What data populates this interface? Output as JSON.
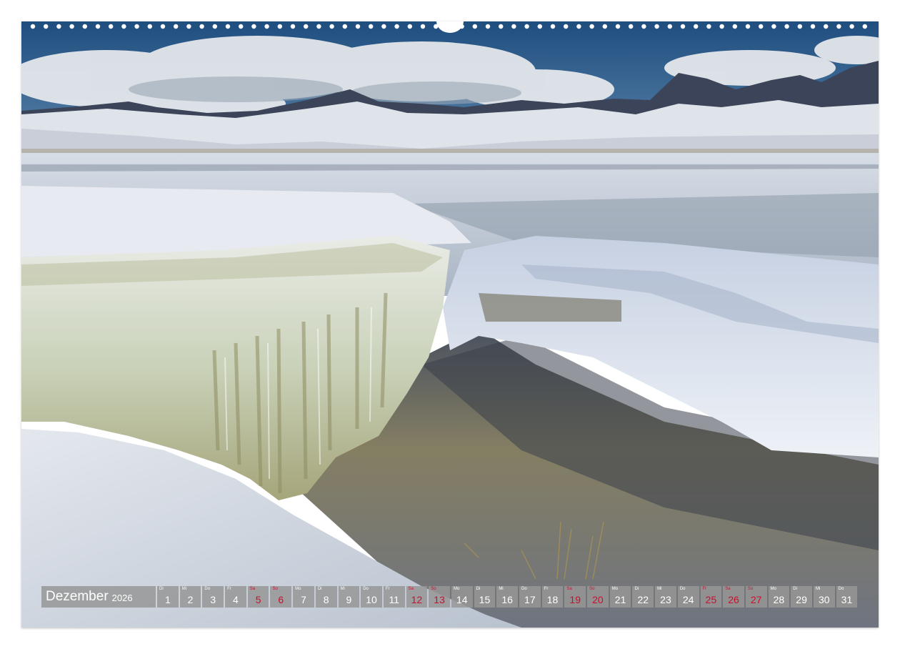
{
  "calendar": {
    "month": "Dezember",
    "year": "2026",
    "days": [
      {
        "wd": "Di",
        "n": "1",
        "weekend": false
      },
      {
        "wd": "Mi",
        "n": "2",
        "weekend": false
      },
      {
        "wd": "Do",
        "n": "3",
        "weekend": false
      },
      {
        "wd": "Fr",
        "n": "4",
        "weekend": false
      },
      {
        "wd": "Sa",
        "n": "5",
        "weekend": true
      },
      {
        "wd": "So",
        "n": "6",
        "weekend": true
      },
      {
        "wd": "Mo",
        "n": "7",
        "weekend": false
      },
      {
        "wd": "Di",
        "n": "8",
        "weekend": false
      },
      {
        "wd": "Mi",
        "n": "9",
        "weekend": false
      },
      {
        "wd": "Do",
        "n": "10",
        "weekend": false
      },
      {
        "wd": "Fr",
        "n": "11",
        "weekend": false
      },
      {
        "wd": "Sa",
        "n": "12",
        "weekend": true
      },
      {
        "wd": "So",
        "n": "13",
        "weekend": true
      },
      {
        "wd": "Mo",
        "n": "14",
        "weekend": false
      },
      {
        "wd": "Di",
        "n": "15",
        "weekend": false
      },
      {
        "wd": "Mi",
        "n": "16",
        "weekend": false
      },
      {
        "wd": "Do",
        "n": "17",
        "weekend": false
      },
      {
        "wd": "Fr",
        "n": "18",
        "weekend": false
      },
      {
        "wd": "Sa",
        "n": "19",
        "weekend": true
      },
      {
        "wd": "So",
        "n": "20",
        "weekend": true
      },
      {
        "wd": "Mo",
        "n": "21",
        "weekend": false
      },
      {
        "wd": "Di",
        "n": "22",
        "weekend": false
      },
      {
        "wd": "Mi",
        "n": "23",
        "weekend": false
      },
      {
        "wd": "Do",
        "n": "24",
        "weekend": false
      },
      {
        "wd": "Fr",
        "n": "25",
        "weekend": true
      },
      {
        "wd": "Sa",
        "n": "26",
        "weekend": true
      },
      {
        "wd": "So",
        "n": "27",
        "weekend": true
      },
      {
        "wd": "Mo",
        "n": "28",
        "weekend": false
      },
      {
        "wd": "Di",
        "n": "29",
        "weekend": false
      },
      {
        "wd": "Mi",
        "n": "30",
        "weekend": false
      },
      {
        "wd": "Do",
        "n": "31",
        "weekend": false
      }
    ]
  },
  "colors": {
    "sky": "#2f5f8e",
    "snow": "#e6eaf0",
    "ice": "#cfd6c0",
    "water": "#7c7a68",
    "weekend_red": "#c8102e"
  }
}
